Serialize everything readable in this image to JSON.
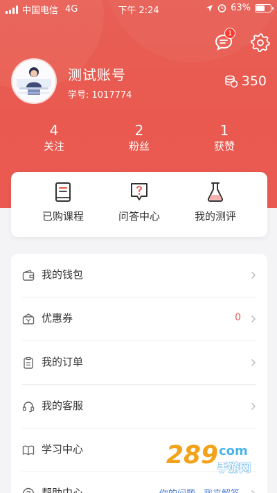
{
  "status_bar": {
    "carrier": "中国电信",
    "network": "4G",
    "time": "下午 2:24",
    "battery": "63%",
    "battery_level": 0.63
  },
  "header": {
    "message_badge": "1",
    "username": "测试账号",
    "student_id": "学号: 1017774",
    "coins": "350"
  },
  "stats": [
    {
      "value": "4",
      "label": "关注"
    },
    {
      "value": "2",
      "label": "粉丝"
    },
    {
      "value": "1",
      "label": "获赞"
    }
  ],
  "quick_actions": [
    {
      "label": "已购课程",
      "icon": "book-icon"
    },
    {
      "label": "问答中心",
      "icon": "question-bubble-icon"
    },
    {
      "label": "我的测评",
      "icon": "flask-icon"
    }
  ],
  "menu": [
    {
      "label": "我的钱包",
      "icon": "wallet-icon"
    },
    {
      "label": "优惠券",
      "icon": "coupon-icon",
      "value": "0"
    },
    {
      "label": "我的订单",
      "icon": "clipboard-icon"
    },
    {
      "label": "我的客服",
      "icon": "headset-icon"
    },
    {
      "label": "学习中心",
      "icon": "open-book-icon"
    },
    {
      "label": "帮助中心",
      "icon": "help-icon",
      "links": [
        "你的问题",
        "我来解答"
      ]
    }
  ],
  "watermark": {
    "main": "289",
    "suffix": "com",
    "sub": "手游网"
  },
  "colors": {
    "accent": "#e9594f",
    "badge": "#ff3b30",
    "link": "#4a7bd6"
  }
}
